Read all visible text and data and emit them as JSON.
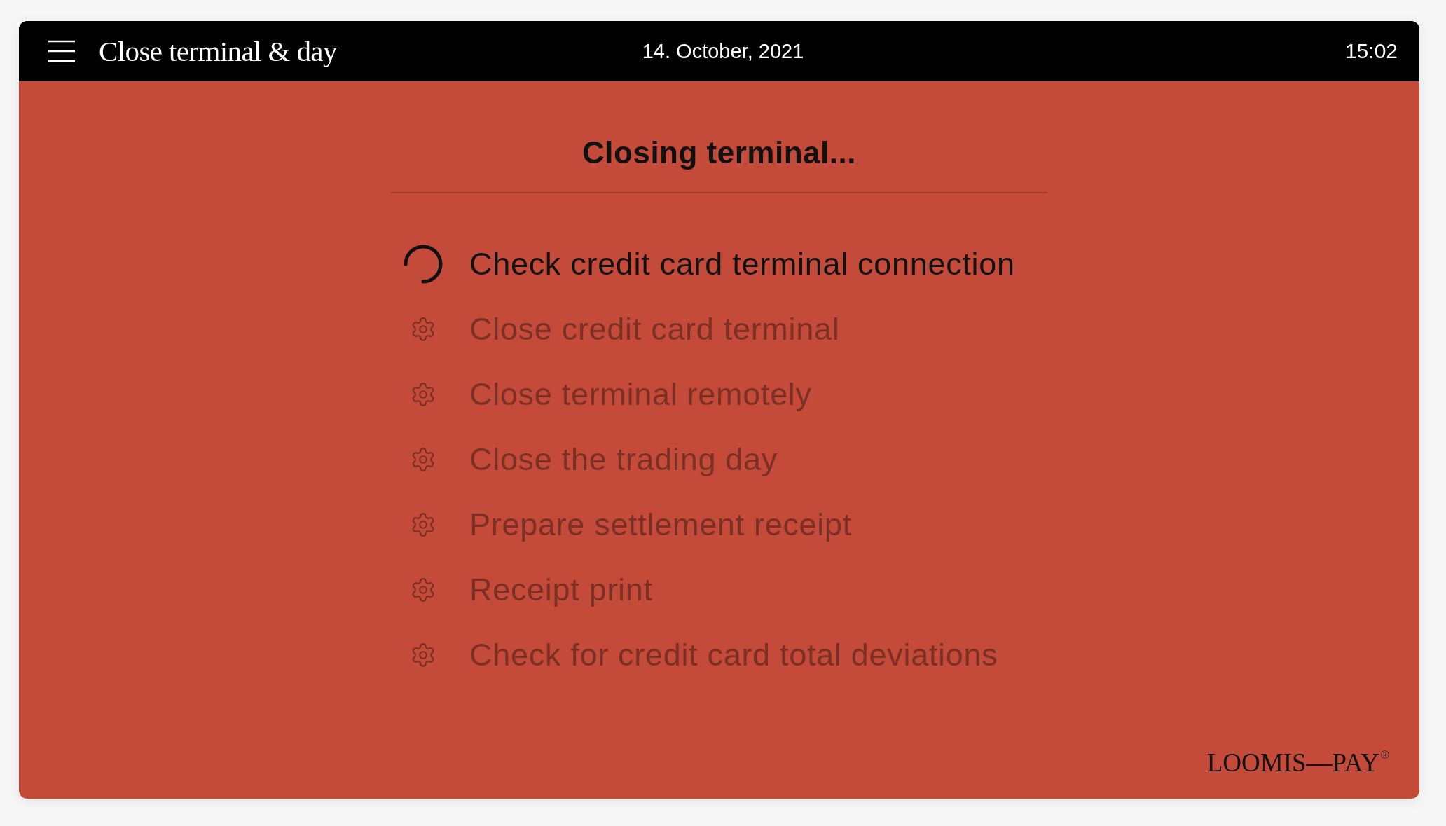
{
  "header": {
    "title": "Close terminal & day",
    "date": "14. October, 2021",
    "time": "15:02"
  },
  "heading": "Closing terminal...",
  "steps": [
    {
      "label": "Check credit card terminal connection",
      "active": true
    },
    {
      "label": "Close credit card terminal",
      "active": false
    },
    {
      "label": "Close terminal remotely",
      "active": false
    },
    {
      "label": "Close the trading day",
      "active": false
    },
    {
      "label": "Prepare settlement receipt",
      "active": false
    },
    {
      "label": "Receipt print",
      "active": false
    },
    {
      "label": "Check for credit card total deviations",
      "active": false
    }
  ],
  "logo": "LOOMIS—PAY$^{®}$"
}
